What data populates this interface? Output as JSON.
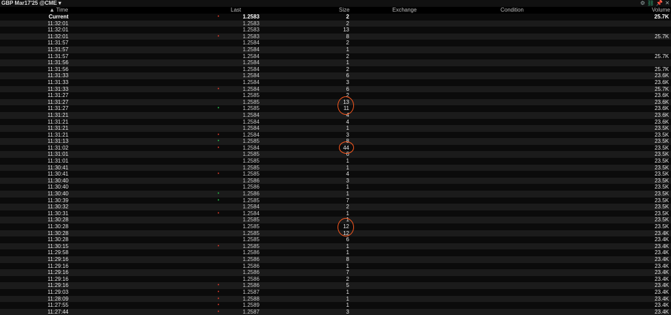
{
  "window": {
    "title": "GBP Mar17'25 @CME ▾",
    "icons": [
      "gear-icon",
      "link-icon",
      "pin-icon",
      "close-icon"
    ]
  },
  "columns": {
    "time": "▲ Time",
    "last": "Last",
    "size": "Size",
    "exchange": "Exchange",
    "condition": "Condition",
    "volume": "Volume"
  },
  "colors": {
    "uptick": "#23c04a",
    "downtick": "#e03b2a",
    "annotation": "#ff5a1f"
  },
  "rows": [
    {
      "time": "Current",
      "last": "1.2583",
      "size": "2",
      "volume": "25.7K",
      "tick": "red",
      "current": true
    },
    {
      "time": "11:32:01",
      "last": "1.2583",
      "size": "2",
      "volume": "",
      "tick": ""
    },
    {
      "time": "11:32:01",
      "last": "1.2583",
      "size": "13",
      "volume": "",
      "tick": ""
    },
    {
      "time": "11:32:01",
      "last": "1.2583",
      "size": "8",
      "volume": "25.7K",
      "tick": "red"
    },
    {
      "time": "11:31:57",
      "last": "1.2584",
      "size": "2",
      "volume": "",
      "tick": ""
    },
    {
      "time": "11:31:57",
      "last": "1.2584",
      "size": "1",
      "volume": "",
      "tick": ""
    },
    {
      "time": "11:31:57",
      "last": "1.2584",
      "size": "2",
      "volume": "25.7K",
      "tick": ""
    },
    {
      "time": "11:31:56",
      "last": "1.2584",
      "size": "1",
      "volume": "",
      "tick": ""
    },
    {
      "time": "11:31:56",
      "last": "1.2584",
      "size": "2",
      "volume": "25.7K",
      "tick": ""
    },
    {
      "time": "11:31:33",
      "last": "1.2584",
      "size": "6",
      "volume": "23.6K",
      "tick": ""
    },
    {
      "time": "11:31:33",
      "last": "1.2584",
      "size": "3",
      "volume": "23.6K",
      "tick": ""
    },
    {
      "time": "11:31:33",
      "last": "1.2584",
      "size": "6",
      "volume": "25.7K",
      "tick": "red"
    },
    {
      "time": "11:31:27",
      "last": "1.2585",
      "size": "2",
      "volume": "23.6K",
      "tick": ""
    },
    {
      "time": "11:31:27",
      "last": "1.2585",
      "size": "13",
      "volume": "23.6K",
      "tick": ""
    },
    {
      "time": "11:31:27",
      "last": "1.2585",
      "size": "11",
      "volume": "23.6K",
      "tick": "green"
    },
    {
      "time": "11:31:21",
      "last": "1.2584",
      "size": "4",
      "volume": "23.6K",
      "tick": ""
    },
    {
      "time": "11:31:21",
      "last": "1.2584",
      "size": "4",
      "volume": "23.6K",
      "tick": ""
    },
    {
      "time": "11:31:21",
      "last": "1.2584",
      "size": "1",
      "volume": "23.5K",
      "tick": ""
    },
    {
      "time": "11:31:21",
      "last": "1.2584",
      "size": "3",
      "volume": "23.5K",
      "tick": "red"
    },
    {
      "time": "11:31:13",
      "last": "1.2585",
      "size": "8",
      "volume": "23.5K",
      "tick": "green"
    },
    {
      "time": "11:31:02",
      "last": "1.2584",
      "size": "44",
      "volume": "23.5K",
      "tick": "red"
    },
    {
      "time": "11:31:01",
      "last": "1.2585",
      "size": "6",
      "volume": "23.5K",
      "tick": ""
    },
    {
      "time": "11:31:01",
      "last": "1.2585",
      "size": "1",
      "volume": "23.5K",
      "tick": ""
    },
    {
      "time": "11:30:41",
      "last": "1.2585",
      "size": "1",
      "volume": "23.5K",
      "tick": ""
    },
    {
      "time": "11:30:41",
      "last": "1.2585",
      "size": "4",
      "volume": "23.5K",
      "tick": "red"
    },
    {
      "time": "11:30:40",
      "last": "1.2586",
      "size": "3",
      "volume": "23.5K",
      "tick": ""
    },
    {
      "time": "11:30:40",
      "last": "1.2586",
      "size": "1",
      "volume": "23.5K",
      "tick": ""
    },
    {
      "time": "11:30:40",
      "last": "1.2586",
      "size": "1",
      "volume": "23.5K",
      "tick": "green"
    },
    {
      "time": "11:30:39",
      "last": "1.2585",
      "size": "7",
      "volume": "23.5K",
      "tick": "green"
    },
    {
      "time": "11:30:32",
      "last": "1.2584",
      "size": "2",
      "volume": "23.5K",
      "tick": ""
    },
    {
      "time": "11:30:31",
      "last": "1.2584",
      "size": "1",
      "volume": "23.5K",
      "tick": "red"
    },
    {
      "time": "11:30:28",
      "last": "1.2585",
      "size": "1",
      "volume": "23.5K",
      "tick": ""
    },
    {
      "time": "11:30:28",
      "last": "1.2585",
      "size": "12",
      "volume": "23.5K",
      "tick": ""
    },
    {
      "time": "11:30:28",
      "last": "1.2585",
      "size": "12",
      "volume": "23.4K",
      "tick": ""
    },
    {
      "time": "11:30:28",
      "last": "1.2585",
      "size": "6",
      "volume": "23.4K",
      "tick": ""
    },
    {
      "time": "11:30:15",
      "last": "1.2585",
      "size": "1",
      "volume": "23.4K",
      "tick": "red"
    },
    {
      "time": "11:29:58",
      "last": "1.2586",
      "size": "1",
      "volume": "23.4K",
      "tick": ""
    },
    {
      "time": "11:29:16",
      "last": "1.2586",
      "size": "8",
      "volume": "23.4K",
      "tick": ""
    },
    {
      "time": "11:29:16",
      "last": "1.2586",
      "size": "1",
      "volume": "23.4K",
      "tick": ""
    },
    {
      "time": "11:29:16",
      "last": "1.2586",
      "size": "7",
      "volume": "23.4K",
      "tick": ""
    },
    {
      "time": "11:29:16",
      "last": "1.2586",
      "size": "2",
      "volume": "23.4K",
      "tick": ""
    },
    {
      "time": "11:29:16",
      "last": "1.2586",
      "size": "5",
      "volume": "23.4K",
      "tick": "red"
    },
    {
      "time": "11:29:03",
      "last": "1.2587",
      "size": "1",
      "volume": "23.4K",
      "tick": "red"
    },
    {
      "time": "11:28:09",
      "last": "1.2588",
      "size": "1",
      "volume": "23.4K",
      "tick": "red"
    },
    {
      "time": "11:27:55",
      "last": "1.2589",
      "size": "1",
      "volume": "23.4K",
      "tick": "red"
    },
    {
      "time": "11:27:44",
      "last": "1.2587",
      "size": "3",
      "volume": "23.4K",
      "tick": "red"
    }
  ]
}
